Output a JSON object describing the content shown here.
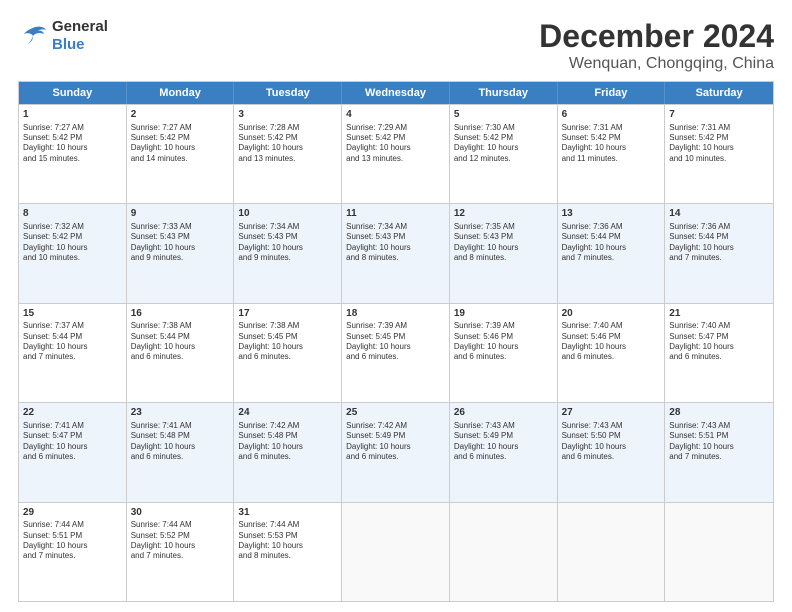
{
  "logo": {
    "general": "General",
    "blue": "Blue"
  },
  "title": "December 2024",
  "location": "Wenquan, Chongqing, China",
  "headers": [
    "Sunday",
    "Monday",
    "Tuesday",
    "Wednesday",
    "Thursday",
    "Friday",
    "Saturday"
  ],
  "rows": [
    [
      {
        "day": "1",
        "text": "Sunrise: 7:27 AM\nSunset: 5:42 PM\nDaylight: 10 hours\nand 15 minutes.",
        "empty": false
      },
      {
        "day": "2",
        "text": "Sunrise: 7:27 AM\nSunset: 5:42 PM\nDaylight: 10 hours\nand 14 minutes.",
        "empty": false
      },
      {
        "day": "3",
        "text": "Sunrise: 7:28 AM\nSunset: 5:42 PM\nDaylight: 10 hours\nand 13 minutes.",
        "empty": false
      },
      {
        "day": "4",
        "text": "Sunrise: 7:29 AM\nSunset: 5:42 PM\nDaylight: 10 hours\nand 13 minutes.",
        "empty": false
      },
      {
        "day": "5",
        "text": "Sunrise: 7:30 AM\nSunset: 5:42 PM\nDaylight: 10 hours\nand 12 minutes.",
        "empty": false
      },
      {
        "day": "6",
        "text": "Sunrise: 7:31 AM\nSunset: 5:42 PM\nDaylight: 10 hours\nand 11 minutes.",
        "empty": false
      },
      {
        "day": "7",
        "text": "Sunrise: 7:31 AM\nSunset: 5:42 PM\nDaylight: 10 hours\nand 10 minutes.",
        "empty": false
      }
    ],
    [
      {
        "day": "8",
        "text": "Sunrise: 7:32 AM\nSunset: 5:42 PM\nDaylight: 10 hours\nand 10 minutes.",
        "empty": false
      },
      {
        "day": "9",
        "text": "Sunrise: 7:33 AM\nSunset: 5:43 PM\nDaylight: 10 hours\nand 9 minutes.",
        "empty": false
      },
      {
        "day": "10",
        "text": "Sunrise: 7:34 AM\nSunset: 5:43 PM\nDaylight: 10 hours\nand 9 minutes.",
        "empty": false
      },
      {
        "day": "11",
        "text": "Sunrise: 7:34 AM\nSunset: 5:43 PM\nDaylight: 10 hours\nand 8 minutes.",
        "empty": false
      },
      {
        "day": "12",
        "text": "Sunrise: 7:35 AM\nSunset: 5:43 PM\nDaylight: 10 hours\nand 8 minutes.",
        "empty": false
      },
      {
        "day": "13",
        "text": "Sunrise: 7:36 AM\nSunset: 5:44 PM\nDaylight: 10 hours\nand 7 minutes.",
        "empty": false
      },
      {
        "day": "14",
        "text": "Sunrise: 7:36 AM\nSunset: 5:44 PM\nDaylight: 10 hours\nand 7 minutes.",
        "empty": false
      }
    ],
    [
      {
        "day": "15",
        "text": "Sunrise: 7:37 AM\nSunset: 5:44 PM\nDaylight: 10 hours\nand 7 minutes.",
        "empty": false
      },
      {
        "day": "16",
        "text": "Sunrise: 7:38 AM\nSunset: 5:44 PM\nDaylight: 10 hours\nand 6 minutes.",
        "empty": false
      },
      {
        "day": "17",
        "text": "Sunrise: 7:38 AM\nSunset: 5:45 PM\nDaylight: 10 hours\nand 6 minutes.",
        "empty": false
      },
      {
        "day": "18",
        "text": "Sunrise: 7:39 AM\nSunset: 5:45 PM\nDaylight: 10 hours\nand 6 minutes.",
        "empty": false
      },
      {
        "day": "19",
        "text": "Sunrise: 7:39 AM\nSunset: 5:46 PM\nDaylight: 10 hours\nand 6 minutes.",
        "empty": false
      },
      {
        "day": "20",
        "text": "Sunrise: 7:40 AM\nSunset: 5:46 PM\nDaylight: 10 hours\nand 6 minutes.",
        "empty": false
      },
      {
        "day": "21",
        "text": "Sunrise: 7:40 AM\nSunset: 5:47 PM\nDaylight: 10 hours\nand 6 minutes.",
        "empty": false
      }
    ],
    [
      {
        "day": "22",
        "text": "Sunrise: 7:41 AM\nSunset: 5:47 PM\nDaylight: 10 hours\nand 6 minutes.",
        "empty": false
      },
      {
        "day": "23",
        "text": "Sunrise: 7:41 AM\nSunset: 5:48 PM\nDaylight: 10 hours\nand 6 minutes.",
        "empty": false
      },
      {
        "day": "24",
        "text": "Sunrise: 7:42 AM\nSunset: 5:48 PM\nDaylight: 10 hours\nand 6 minutes.",
        "empty": false
      },
      {
        "day": "25",
        "text": "Sunrise: 7:42 AM\nSunset: 5:49 PM\nDaylight: 10 hours\nand 6 minutes.",
        "empty": false
      },
      {
        "day": "26",
        "text": "Sunrise: 7:43 AM\nSunset: 5:49 PM\nDaylight: 10 hours\nand 6 minutes.",
        "empty": false
      },
      {
        "day": "27",
        "text": "Sunrise: 7:43 AM\nSunset: 5:50 PM\nDaylight: 10 hours\nand 6 minutes.",
        "empty": false
      },
      {
        "day": "28",
        "text": "Sunrise: 7:43 AM\nSunset: 5:51 PM\nDaylight: 10 hours\nand 7 minutes.",
        "empty": false
      }
    ],
    [
      {
        "day": "29",
        "text": "Sunrise: 7:44 AM\nSunset: 5:51 PM\nDaylight: 10 hours\nand 7 minutes.",
        "empty": false
      },
      {
        "day": "30",
        "text": "Sunrise: 7:44 AM\nSunset: 5:52 PM\nDaylight: 10 hours\nand 7 minutes.",
        "empty": false
      },
      {
        "day": "31",
        "text": "Sunrise: 7:44 AM\nSunset: 5:53 PM\nDaylight: 10 hours\nand 8 minutes.",
        "empty": false
      },
      {
        "day": "",
        "text": "",
        "empty": true
      },
      {
        "day": "",
        "text": "",
        "empty": true
      },
      {
        "day": "",
        "text": "",
        "empty": true
      },
      {
        "day": "",
        "text": "",
        "empty": true
      }
    ]
  ]
}
